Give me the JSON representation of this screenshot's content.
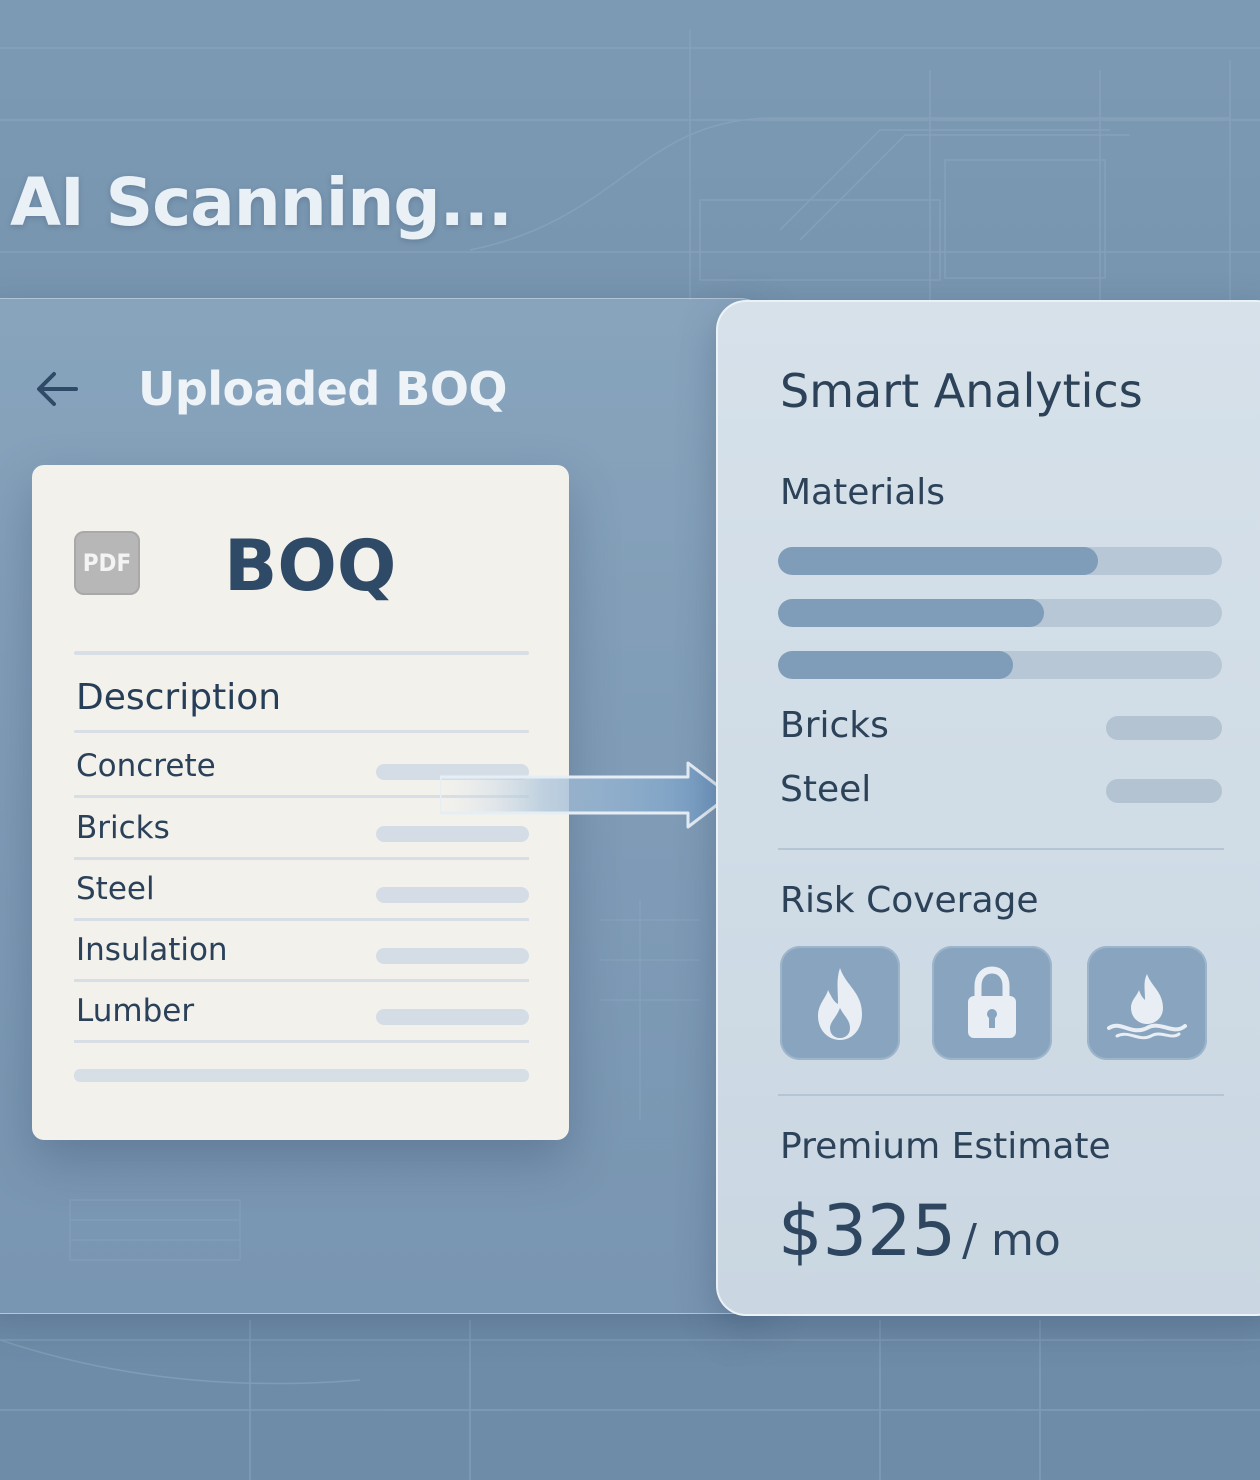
{
  "header": {
    "title": "AI Scanning..."
  },
  "left_panel": {
    "title": "Uploaded BOQ",
    "back_icon": "arrow-left-icon",
    "document": {
      "file_icon_label": "PDF",
      "title": "BOQ",
      "column_header": "Description",
      "rows": [
        {
          "label": "Concrete"
        },
        {
          "label": "Bricks"
        },
        {
          "label": "Steel"
        },
        {
          "label": "Insulation"
        },
        {
          "label": "Lumber"
        }
      ]
    }
  },
  "right_panel": {
    "title": "Smart Analytics",
    "materials": {
      "heading": "Materials",
      "bars": [
        0.72,
        0.6,
        0.53
      ],
      "items": [
        {
          "label": "Bricks"
        },
        {
          "label": "Steel"
        }
      ]
    },
    "risk": {
      "heading": "Risk Coverage",
      "icons": [
        "fire-icon",
        "lock-icon",
        "flood-fire-icon"
      ]
    },
    "premium": {
      "heading": "Premium Estimate",
      "amount": "$325",
      "period": "/ mo"
    }
  },
  "colors": {
    "background": "#7290ab",
    "card": "#f3f1ec",
    "text_dark": "#2c4258",
    "bar_fill": "#7f9cb8",
    "bar_track": "#b7c7d6",
    "tile": "#88a4be"
  }
}
